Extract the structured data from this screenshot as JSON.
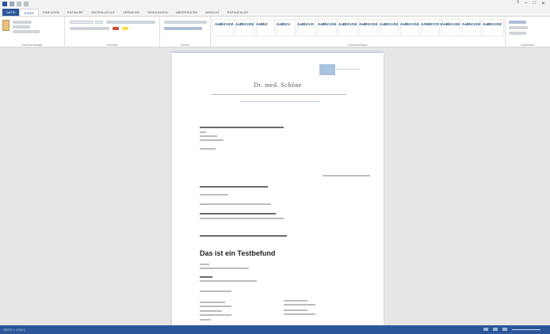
{
  "window": {
    "title": "",
    "controls": [
      "?",
      "–",
      "□",
      "✕"
    ]
  },
  "ribbon": {
    "tabs": [
      "DATEI",
      "START",
      "EINFÜGEN",
      "ENTWURF",
      "SEITENLAYOUT",
      "VERWEISE",
      "SENDUNGEN",
      "ÜBERPRÜFEN",
      "ANSICHT",
      "ENTWICKLER"
    ],
    "active_tab": "START",
    "user": "",
    "groups": [
      "Zwischenablage",
      "Schriftart",
      "Absatz",
      "Formatvorlagen",
      "Bearbeiten"
    ],
    "styles": [
      "AaBbCcDd",
      "AaBbCcDd",
      "AaBbC",
      "AaBbCc",
      "AaBbCcD",
      "AaBbCcDd",
      "AaBbCcDd",
      "AaBbCcDd",
      "AaBbCcDd",
      "AaBbCcDd",
      "AABBCCDD",
      "AaBbCcDd",
      "AaBbCcDd",
      "AaBbCcDd"
    ]
  },
  "document": {
    "doctor_name": "Dr. med. Schöne",
    "body_title": "Das ist ein Testbefund",
    "date": ""
  },
  "status": {
    "page": "SEITE 1 VON 1",
    "words": "",
    "language": "",
    "zoom": ""
  }
}
